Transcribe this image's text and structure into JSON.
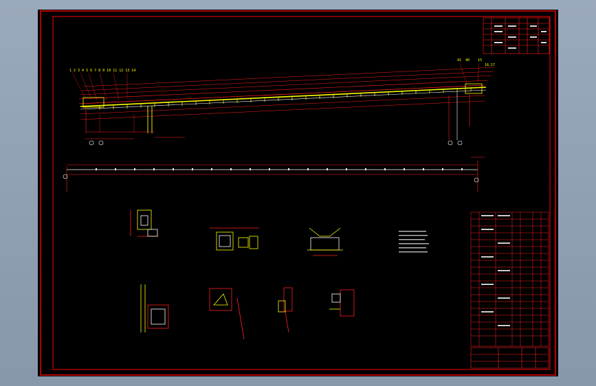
{
  "conveyor_labels": {
    "top_left_numbers": "1 2 3 4 5 6 7   8   9 10 11 12 13   14",
    "right_numbers_a": "41",
    "right_numbers_b": "40",
    "right_numbers_c": "15",
    "right_numbers_d": "16,17"
  },
  "colors": {
    "frame": "#ff0000",
    "yellow": "#ffff00",
    "white": "#ffffff",
    "red": "#ff2020"
  },
  "icons": [
    "title-block-icon",
    "parts-table-icon",
    "conveyor-elevation-icon",
    "conveyor-plan-icon",
    "drive-unit-icon",
    "idler-icon",
    "section-detail-icon"
  ]
}
